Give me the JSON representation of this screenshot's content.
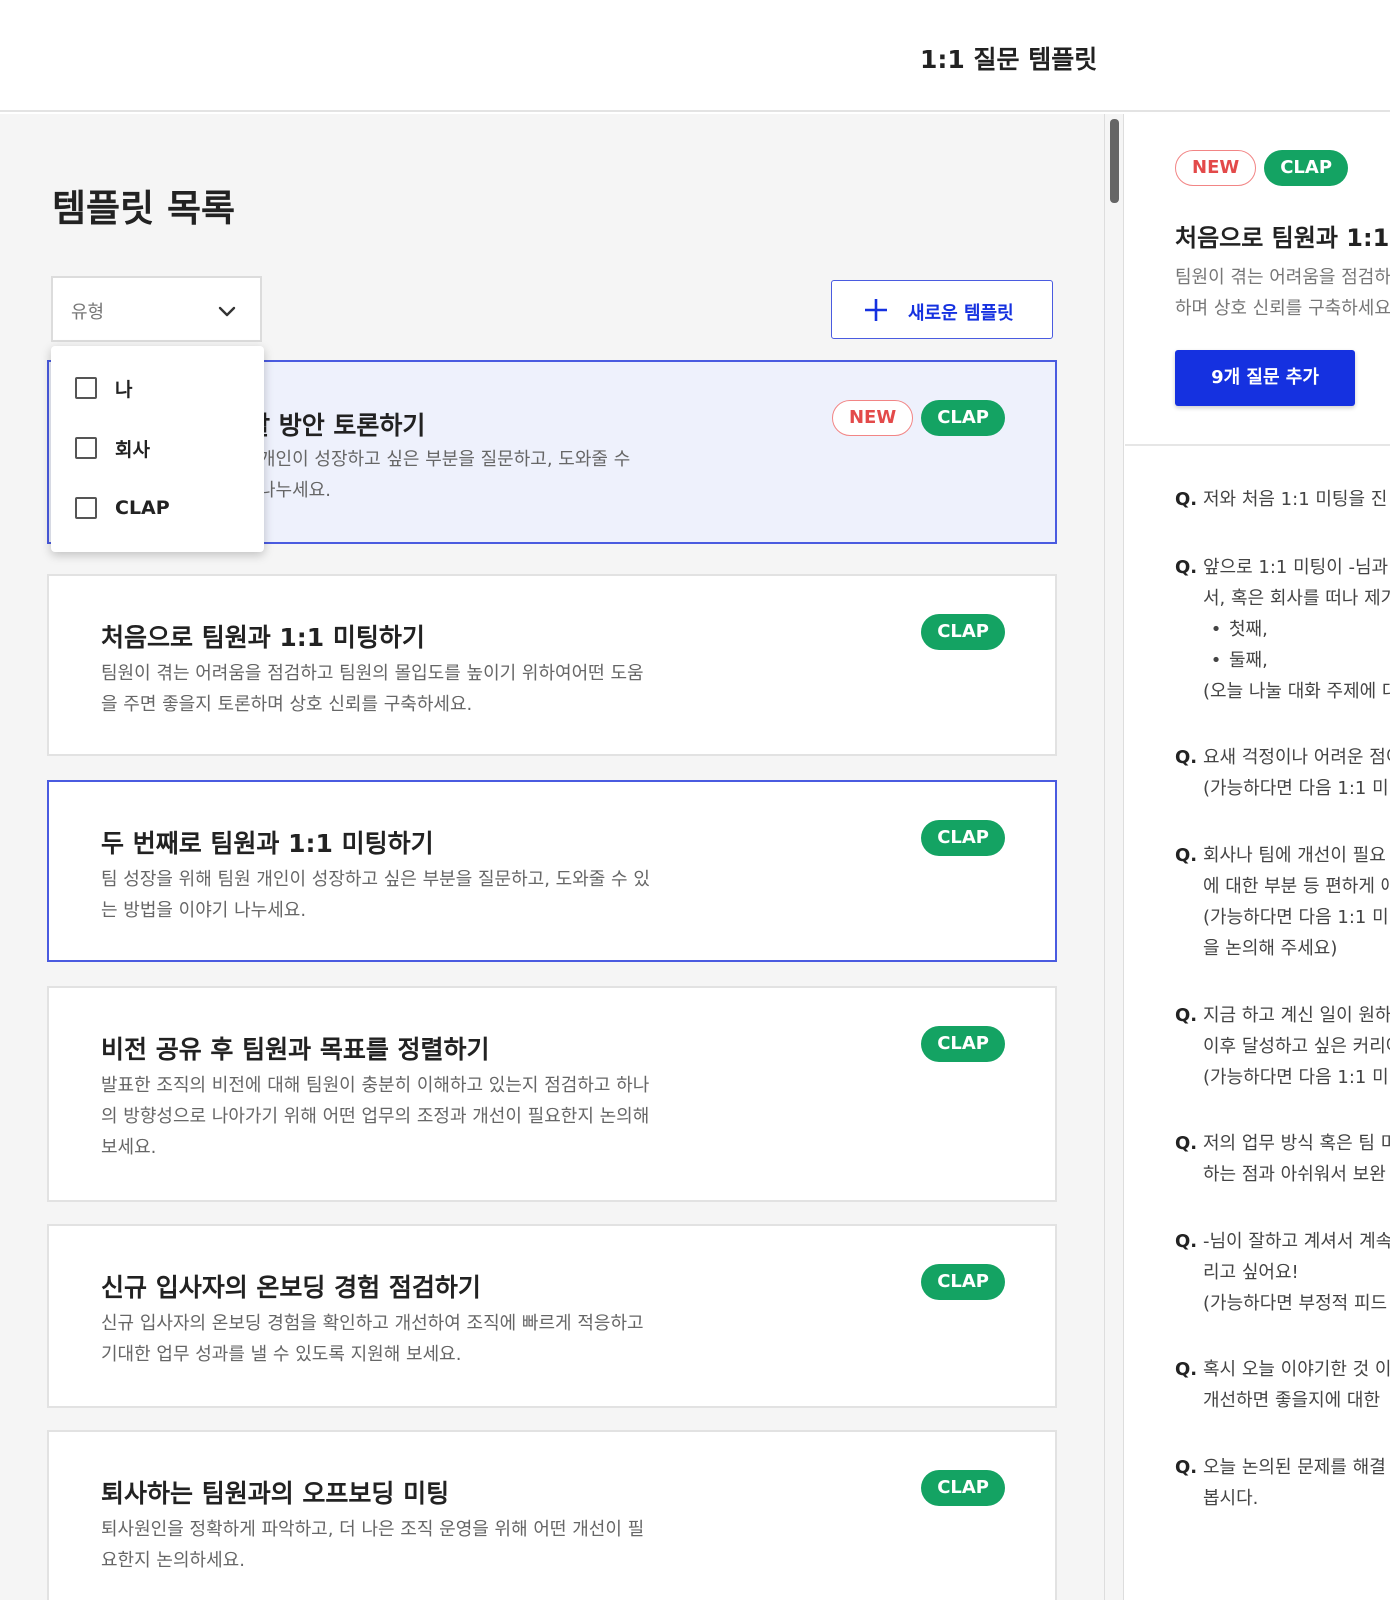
{
  "header": {
    "title": "1:1 질문 템플릿"
  },
  "left": {
    "title": "템플릿 목록",
    "type_filter": {
      "label": "유형",
      "options": [
        "나",
        "회사",
        "CLAP"
      ]
    },
    "new_template_label": "새로운 템플릿",
    "cards": [
      {
        "title": "할 방안 토론하기",
        "desc": "개인이 성장하고 싶은 부분을 질문하고, 도와줄 수 나누세요.",
        "badges": [
          "NEW",
          "CLAP"
        ]
      },
      {
        "title": "처음으로 팀원과 1:1 미팅하기",
        "desc": "팀원이 겪는 어려움을 점검하고 팀원의 몰입도를 높이기 위하여어떤 도움을 주면 좋을지 토론하며 상호 신뢰를 구축하세요.",
        "badges": [
          "CLAP"
        ]
      },
      {
        "title": "두 번째로 팀원과 1:1 미팅하기",
        "desc": "팀 성장을 위해 팀원 개인이 성장하고 싶은 부분을 질문하고, 도와줄 수 있는 방법을 이야기 나누세요.",
        "badges": [
          "CLAP"
        ]
      },
      {
        "title": "비전 공유 후 팀원과 목표를 정렬하기",
        "desc": "발표한 조직의 비전에 대해 팀원이 충분히 이해하고 있는지 점검하고 하나의 방향성으로 나아가기 위해 어떤 업무의 조정과 개선이 필요한지 논의해 보세요.",
        "badges": [
          "CLAP"
        ]
      },
      {
        "title": "신규 입사자의 온보딩 경험 점검하기",
        "desc": "신규 입사자의 온보딩 경험을 확인하고 개선하여 조직에 빠르게 적응하고 기대한 업무 성과를 낼 수 있도록 지원해 보세요.",
        "badges": [
          "CLAP"
        ]
      },
      {
        "title": "퇴사하는 팀원과의 오프보딩 미팅",
        "desc": "퇴사원인을 정확하게 파악하고, 더 나은 조직 운영을 위해 어떤 개선이 필요한지 논의하세요.",
        "badges": [
          "CLAP"
        ]
      }
    ]
  },
  "right": {
    "badges": [
      "NEW",
      "CLAP"
    ],
    "title": "처음으로 팀원과 1:1",
    "desc": "팀원이 겪는 어려움을 점검하 하며 상호 신뢰를 구축하세요",
    "add_button": "9개 질문 추가",
    "question_mark": "Q.",
    "questions": [
      {
        "lines": [
          "저와 처음 1:1 미팅을 진"
        ]
      },
      {
        "lines": [
          "앞으로 1:1 미팅이 -님과",
          "서, 혹은 회사를 떠나 제가"
        ],
        "bullets": [
          "첫째,",
          "둘째,"
        ],
        "after": "(오늘 나눌 대화 주제에 대"
      },
      {
        "lines": [
          "요새 걱정이나 어려운 점이",
          "(가능하다면 다음 1:1 미팅"
        ]
      },
      {
        "lines": [
          "회사나 팀에 개선이 필요",
          "에 대한 부분 등 편하게 얘",
          "(가능하다면 다음 1:1 미팅",
          "을 논의해 주세요)"
        ]
      },
      {
        "lines": [
          "지금 하고 계신 일이 원하",
          "이후 달성하고 싶은 커리어",
          "(가능하다면 다음 1:1 미팅"
        ]
      },
      {
        "lines": [
          "저의 업무 방식 혹은 팀 미",
          "하는 점과 아쉬워서 보완"
        ]
      },
      {
        "lines": [
          "-님이 잘하고 계셔서 계속",
          "리고 싶어요!",
          "(가능하다면 부정적 피드"
        ]
      },
      {
        "lines": [
          "혹시 오늘 이야기한 것 이",
          "개선하면 좋을지에 대한"
        ]
      },
      {
        "lines": [
          "오늘 논의된 문제를 해결",
          "봅시다."
        ]
      }
    ]
  },
  "colors": {
    "accent": "#1531e0",
    "clap": "#14a363",
    "new": "#e34a4a",
    "selected_bg": "#eef1fc"
  }
}
